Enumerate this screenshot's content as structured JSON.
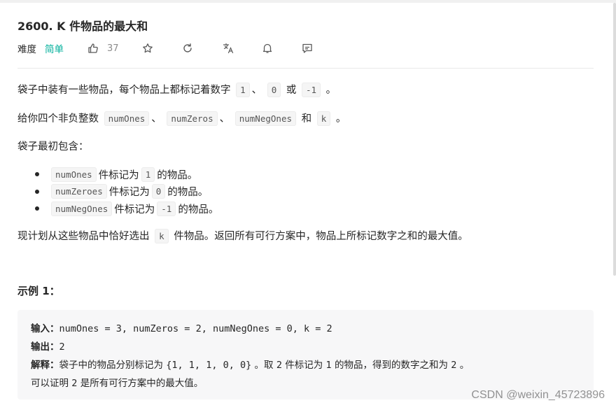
{
  "problem": {
    "title": "2600. K 件物品的最大和",
    "difficulty_label": "难度",
    "difficulty_value": "简单",
    "likes": "37",
    "difficulty_color": "#00af9b"
  },
  "toolbar_icons": [
    "thumbs-up-icon",
    "star-icon",
    "refresh-icon",
    "translate-icon",
    "bell-icon",
    "feedback-icon"
  ],
  "description": {
    "p1": {
      "text": "袋子中装有一些物品，每个物品上都标记着数字",
      "codes": [
        "1",
        "0",
        "-1"
      ],
      "sep": "、",
      "or": "或",
      "end": "。"
    },
    "p2": {
      "text": "给你四个非负整数",
      "codes": [
        "numOnes",
        "numZeros",
        "numNegOnes",
        "k"
      ],
      "sep": "、",
      "and": "和",
      "end": "。"
    },
    "p3": "袋子最初包含：",
    "bullets": [
      {
        "code": "numOnes",
        "mid": "件标记为",
        "value": "1",
        "tail": "的物品。"
      },
      {
        "code": "numZeroes",
        "mid": "件标记为",
        "value": "0",
        "tail": "的物品。"
      },
      {
        "code": "numNegOnes",
        "mid": "件标记为",
        "value": "-1",
        "tail": "的物品。"
      }
    ],
    "p4": {
      "pre": "现计划从这些物品中恰好选出",
      "code": "k",
      "post": "件物品。返回所有可行方案中，物品上所标记数字之和的最大值。"
    }
  },
  "example": {
    "title": "示例 1：",
    "input_label": "输入：",
    "input_value": "numOnes = 3, numZeros = 2, numNegOnes = 0, k = 2",
    "output_label": "输出：",
    "output_value": "2",
    "explain_label": "解释：",
    "explain_1": "袋子中的物品分别标记为 ",
    "explain_2": "{1, 1, 1, 0, 0}",
    "explain_3": " 。取 ",
    "explain_4": "2",
    "explain_5": " 件标记为 ",
    "explain_6": "1",
    "explain_7": " 的物品，得到的数字之和为 ",
    "explain_8": "2",
    "explain_9": " 。",
    "line4_1": "可以证明 ",
    "line4_2": "2",
    "line4_3": " 是所有可行方案中的最大值。"
  },
  "watermark": "CSDN @weixin_45723896"
}
